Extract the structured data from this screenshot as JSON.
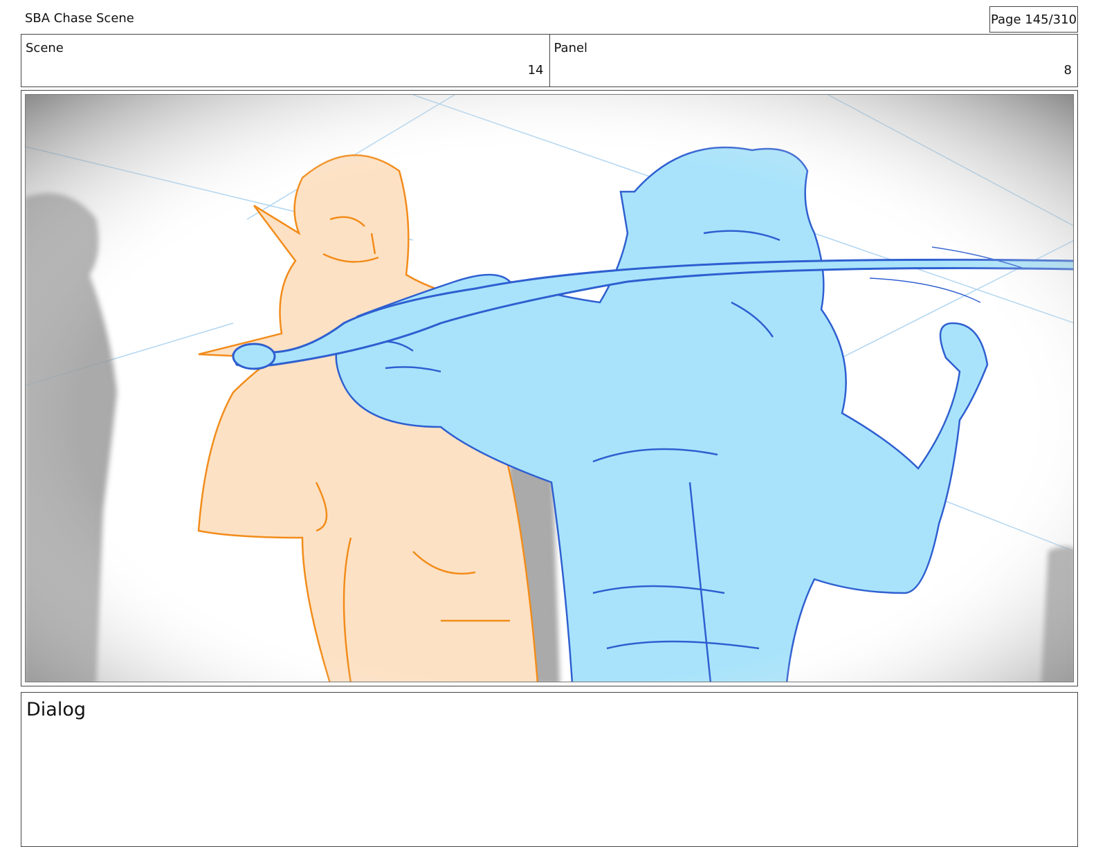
{
  "header": {
    "title": "SBA Chase Scene",
    "page": "Page 145/310"
  },
  "info": {
    "scene_label": "Scene",
    "scene_value": "14",
    "panel_label": "Panel",
    "panel_value": "8"
  },
  "panel": {
    "colors": {
      "orange_line": "#f28c1a",
      "orange_fill": "#fde1c4",
      "blue_line": "#2e5fd0",
      "blue_fill": "#a8e3fb",
      "guide": "#9ccbee",
      "vignette": "#6f6f6f"
    }
  },
  "dialog": {
    "label": "Dialog"
  }
}
